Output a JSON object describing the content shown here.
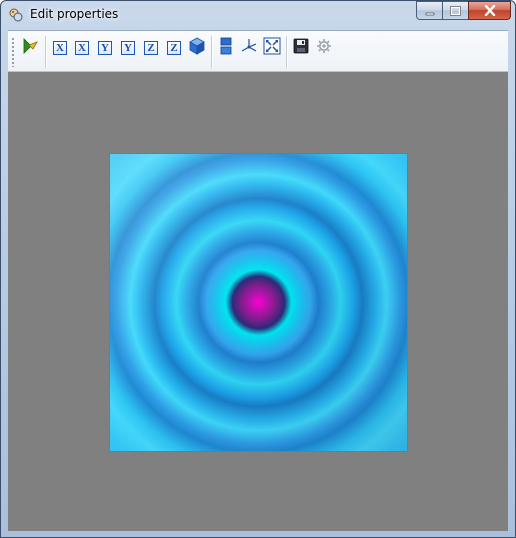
{
  "window": {
    "title": "Edit properties"
  },
  "caption_buttons": {
    "minimize": "minimize-icon",
    "maximize": "maximize-icon",
    "close": "close-icon"
  },
  "toolbar": {
    "buttons": [
      {
        "icon": "select-pointer-icon"
      },
      {
        "icon": "axis-x-icon",
        "label": "X"
      },
      {
        "icon": "axis-x-reverse-icon",
        "label": "X"
      },
      {
        "icon": "axis-y-icon",
        "label": "Y"
      },
      {
        "icon": "axis-y-reverse-icon",
        "label": "Y"
      },
      {
        "icon": "axis-z-icon",
        "label": "Z"
      },
      {
        "icon": "axis-z-reverse-icon",
        "label": "Z"
      },
      {
        "icon": "cube-3d-icon"
      },
      {
        "icon": "color-bar-icon"
      },
      {
        "icon": "axes-icon"
      },
      {
        "icon": "fit-view-icon"
      },
      {
        "icon": "save-icon"
      },
      {
        "icon": "settings-icon"
      }
    ]
  },
  "colors": {
    "viewport_background": "#808080",
    "surface_center": "#ff00d8",
    "surface_ring": "#2ec0f3",
    "surface_dark_ring": "#1f80cf"
  }
}
